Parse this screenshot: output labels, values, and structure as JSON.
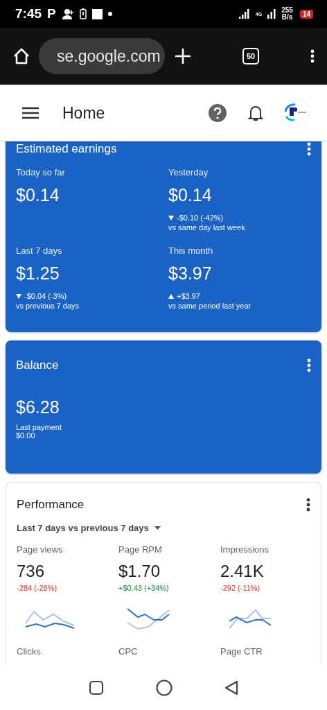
{
  "status_bar": {
    "time": "7:45",
    "carrier": "P",
    "network": "4G",
    "speed": "255",
    "speed_unit": "B/s",
    "battery": "14"
  },
  "browser": {
    "url": "se.google.com",
    "tab_count": "50"
  },
  "header": {
    "title": "Home"
  },
  "earnings": {
    "title": "Estimated earnings",
    "items": [
      {
        "label": "Today so far",
        "value": "$0.14"
      },
      {
        "label": "Yesterday",
        "value": "$0.14",
        "increased": false,
        "change": "-$0.10 (-42%)",
        "comparison": "vs same day last week"
      },
      {
        "label": "Last 7 days",
        "value": "$1.25",
        "increased": false,
        "change": "-$0.04 (-3%)",
        "comparison": "vs previous 7 days"
      },
      {
        "label": "This month",
        "value": "$3.97",
        "increased": true,
        "change": "+$3.97",
        "comparison": "vs same period last year"
      }
    ]
  },
  "balance": {
    "title": "Balance",
    "value": "$6.28",
    "sub_label": "Last payment",
    "sub_value": "$0.00"
  },
  "performance": {
    "title": "Performance",
    "range": "Last 7 days vs previous 7 days",
    "metrics": [
      {
        "label": "Page views",
        "value": "736",
        "increased": false,
        "change": "-284 (-28%)"
      },
      {
        "label": "Page RPM",
        "value": "$1.70",
        "increased": true,
        "change": "+$0.43 (+34%)"
      },
      {
        "label": "Impressions",
        "value": "2.41K",
        "increased": false,
        "change": "-292 (-11%)"
      }
    ],
    "more_metrics": [
      "Clicks",
      "CPC",
      "Page CTR"
    ]
  }
}
